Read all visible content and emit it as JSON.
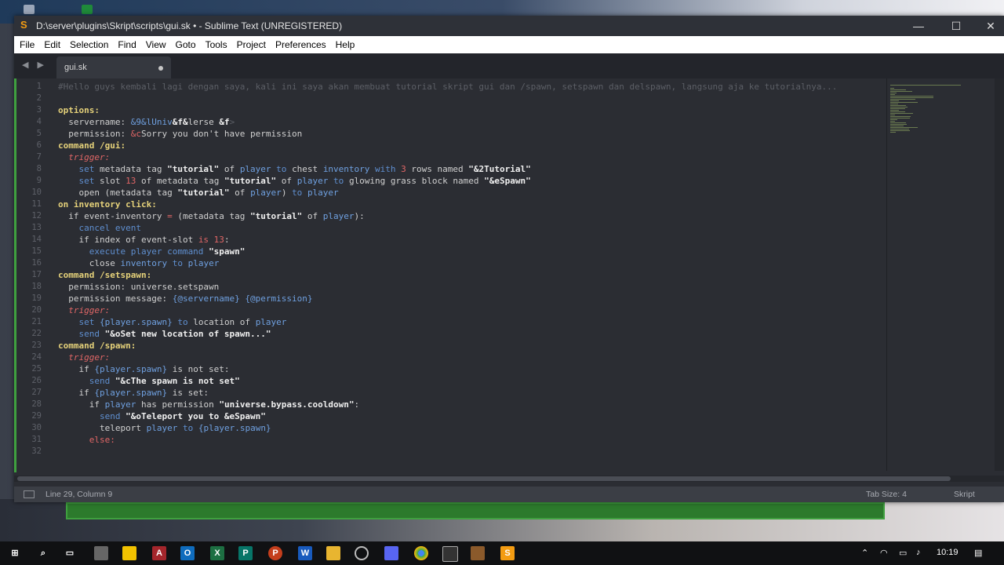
{
  "window": {
    "title": "D:\\server\\plugins\\Skript\\scripts\\gui.sk • - Sublime Text (UNREGISTERED)",
    "controls": [
      "—",
      "☐",
      "✕"
    ]
  },
  "menu": [
    "File",
    "Edit",
    "Selection",
    "Find",
    "View",
    "Goto",
    "Tools",
    "Project",
    "Preferences",
    "Help"
  ],
  "tab": {
    "name": "gui.sk",
    "modified": true
  },
  "nav_arrows": "◀ ▶",
  "code_lines": [
    {
      "n": "1",
      "segs": [
        [
          "cm",
          "#Hello guys kembali lagi dengan saya, kali ini saya akan membuat tutorial skript gui dan /spawn, setspawn dan delspawn, langsung aja ke tutorialnya..."
        ]
      ]
    },
    {
      "n": "2",
      "segs": []
    },
    {
      "n": "3",
      "segs": [
        [
          "hd",
          "options:"
        ]
      ]
    },
    {
      "n": "4",
      "segs": [
        [
          "pl",
          "  servername: "
        ],
        [
          "var",
          "&9&lUniv"
        ],
        [
          "st",
          "&f&"
        ],
        [
          "pl",
          "lerse "
        ],
        [
          "st",
          "&f"
        ],
        [
          "cm",
          ">"
        ]
      ]
    },
    {
      "n": "5",
      "segs": [
        [
          "pl",
          "  permission: "
        ],
        [
          "num",
          "&c"
        ],
        [
          "pl",
          "Sorry you don't have permission"
        ]
      ]
    },
    {
      "n": "6",
      "segs": [
        [
          "hd",
          "command /gui:"
        ]
      ]
    },
    {
      "n": "7",
      "segs": [
        [
          "tg",
          "  trigger:"
        ]
      ]
    },
    {
      "n": "8",
      "segs": [
        [
          "bl",
          "    set "
        ],
        [
          "pl",
          "metadata tag "
        ],
        [
          "st",
          "\"tutorial\""
        ],
        [
          "pl",
          " of "
        ],
        [
          "var",
          "player"
        ],
        [
          "bl",
          " to "
        ],
        [
          "pl",
          "chest "
        ],
        [
          "var",
          "inventory"
        ],
        [
          "bl",
          " with "
        ],
        [
          "num",
          "3"
        ],
        [
          "pl",
          " rows named "
        ],
        [
          "st",
          "\"&2Tutorial\""
        ]
      ]
    },
    {
      "n": "9",
      "segs": [
        [
          "bl",
          "    set "
        ],
        [
          "pl",
          "slot "
        ],
        [
          "num",
          "13"
        ],
        [
          "pl",
          " of metadata tag "
        ],
        [
          "st",
          "\"tutorial\""
        ],
        [
          "pl",
          " of "
        ],
        [
          "var",
          "player"
        ],
        [
          "bl",
          " to "
        ],
        [
          "pl",
          "glowing grass block named "
        ],
        [
          "st",
          "\"&eSpawn\""
        ]
      ]
    },
    {
      "n": "10",
      "segs": [
        [
          "pl",
          "    open (metadata tag "
        ],
        [
          "st",
          "\"tutorial\""
        ],
        [
          "pl",
          " of "
        ],
        [
          "var",
          "player"
        ],
        [
          "pl",
          ") "
        ],
        [
          "bl",
          "to "
        ],
        [
          "var",
          "player"
        ]
      ]
    },
    {
      "n": "11",
      "segs": [
        [
          "hd",
          "on inventory click:"
        ]
      ]
    },
    {
      "n": "12",
      "segs": [
        [
          "pl",
          "  if event-inventory "
        ],
        [
          "num",
          "="
        ],
        [
          "pl",
          " (metadata tag "
        ],
        [
          "st",
          "\"tutorial\""
        ],
        [
          "pl",
          " of "
        ],
        [
          "var",
          "player"
        ],
        [
          "pl",
          "):"
        ]
      ]
    },
    {
      "n": "13",
      "segs": [
        [
          "bl",
          "    cancel event"
        ]
      ]
    },
    {
      "n": "14",
      "segs": [
        [
          "pl",
          "    if index of event-slot "
        ],
        [
          "num",
          "is 13"
        ],
        [
          "pl",
          ":"
        ]
      ]
    },
    {
      "n": "15",
      "segs": [
        [
          "bl",
          "      execute player command "
        ],
        [
          "st",
          "\"spawn\""
        ]
      ]
    },
    {
      "n": "16",
      "segs": [
        [
          "pl",
          "      close "
        ],
        [
          "var",
          "inventory"
        ],
        [
          "bl",
          " to "
        ],
        [
          "var",
          "player"
        ]
      ]
    },
    {
      "n": "17",
      "segs": [
        [
          "hd",
          "command /setspawn:"
        ]
      ]
    },
    {
      "n": "18",
      "segs": [
        [
          "pl",
          "  permission: universe.setspawn"
        ]
      ]
    },
    {
      "n": "19",
      "segs": [
        [
          "pl",
          "  permission message: "
        ],
        [
          "var",
          "{@servername}"
        ],
        [
          "pl",
          " "
        ],
        [
          "var",
          "{@permission}"
        ]
      ]
    },
    {
      "n": "20",
      "segs": [
        [
          "tg",
          "  trigger:"
        ]
      ]
    },
    {
      "n": "21",
      "segs": [
        [
          "bl",
          "    set "
        ],
        [
          "var",
          "{player.spawn}"
        ],
        [
          "bl",
          " to "
        ],
        [
          "pl",
          "location of "
        ],
        [
          "var",
          "player"
        ]
      ]
    },
    {
      "n": "22",
      "segs": [
        [
          "bl",
          "    send "
        ],
        [
          "st",
          "\"&oSet new location of spawn...\""
        ]
      ]
    },
    {
      "n": "23",
      "segs": [
        [
          "hd",
          "command /spawn:"
        ]
      ]
    },
    {
      "n": "24",
      "segs": [
        [
          "tg",
          "  trigger:"
        ]
      ]
    },
    {
      "n": "25",
      "segs": [
        [
          "pl",
          "    if "
        ],
        [
          "var",
          "{player.spawn}"
        ],
        [
          "pl",
          " is not set:"
        ]
      ]
    },
    {
      "n": "26",
      "segs": [
        [
          "bl",
          "      send "
        ],
        [
          "st",
          "\"&cThe spawn is not set\""
        ]
      ]
    },
    {
      "n": "27",
      "segs": [
        [
          "pl",
          "    if "
        ],
        [
          "var",
          "{player.spawn}"
        ],
        [
          "pl",
          " is set:"
        ]
      ]
    },
    {
      "n": "28",
      "segs": [
        [
          "pl",
          "      if "
        ],
        [
          "var",
          "player"
        ],
        [
          "pl",
          " has permission "
        ],
        [
          "st",
          "\"universe.bypass.cooldown\""
        ],
        [
          "pl",
          ":"
        ]
      ]
    },
    {
      "n": "29",
      "segs": [
        [
          "bl",
          "        send "
        ],
        [
          "st",
          "\"&oTeleport you to &eSpawn\""
        ]
      ]
    },
    {
      "n": "30",
      "segs": [
        [
          "pl",
          "        teleport "
        ],
        [
          "var",
          "player"
        ],
        [
          "bl",
          " to "
        ],
        [
          "var",
          "{player.spawn}"
        ]
      ]
    },
    {
      "n": "31",
      "segs": [
        [
          "num",
          "      else:"
        ]
      ]
    },
    {
      "n": "32",
      "segs": []
    }
  ],
  "status": {
    "position": "Line 29, Column 9",
    "tab_size": "Tab Size: 4",
    "syntax": "Skript"
  },
  "taskbar": {
    "time": "10:19"
  },
  "colors": {
    "gutter_accent": "#3fa03f",
    "app_accent": "#f39c12"
  }
}
